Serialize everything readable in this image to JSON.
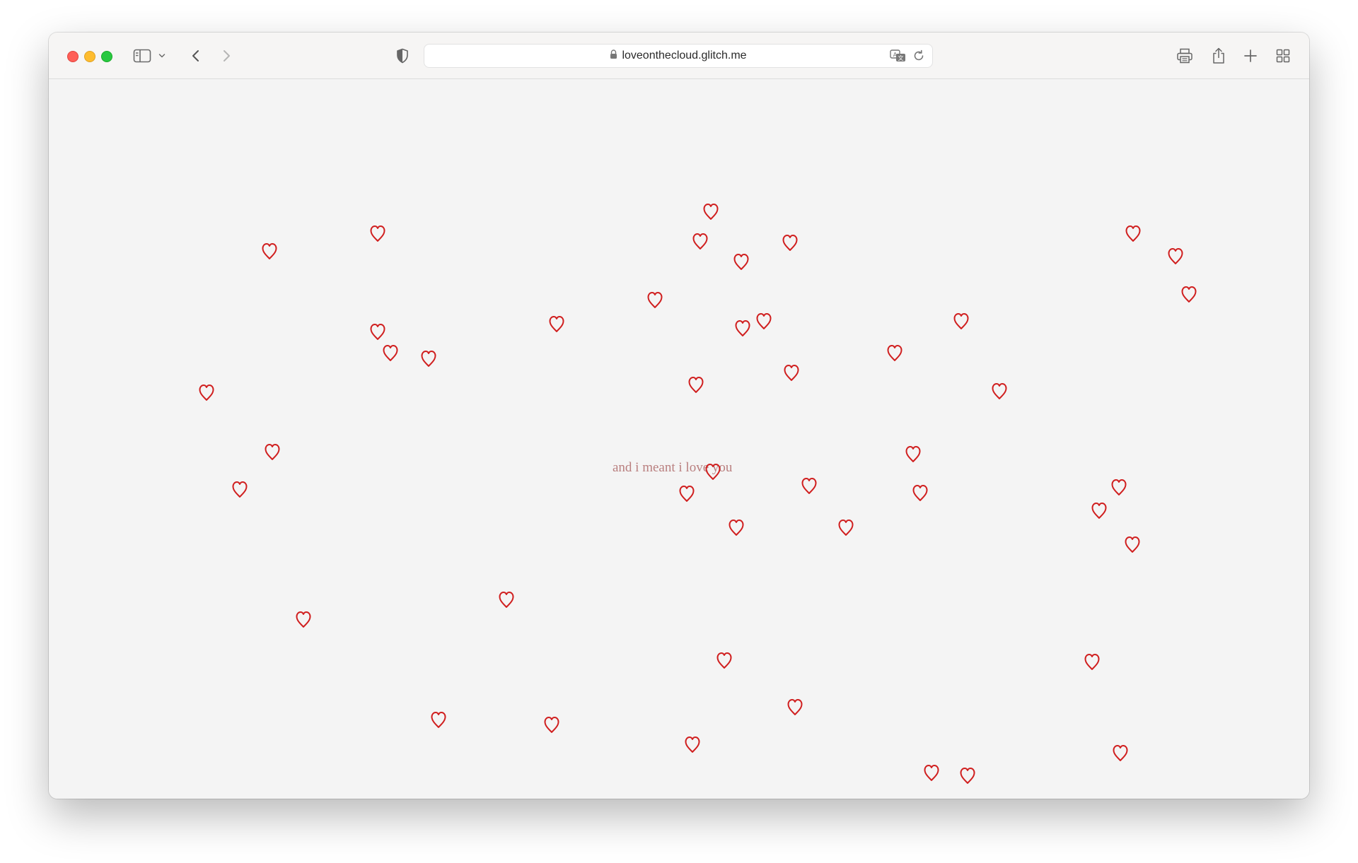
{
  "browser": {
    "url": "loveonthecloud.glitch.me",
    "icons": {
      "sidebar": "sidebar-icon",
      "sidebar_menu": "chevron-down-icon",
      "back": "chevron-left-icon",
      "forward": "chevron-right-icon",
      "privacy": "shield-icon",
      "lock": "lock-icon",
      "translate": "translate-icon",
      "reload": "reload-icon",
      "print": "printer-icon",
      "share": "share-icon",
      "new_tab": "plus-icon",
      "tab_overview": "grid-icon"
    }
  },
  "page": {
    "background": "#f4f4f4",
    "message": "and i meant i love you",
    "message_color": "#b97f7f",
    "heart_color": "#d01f1f",
    "heart_glyph": "heart-outline-icon"
  }
}
